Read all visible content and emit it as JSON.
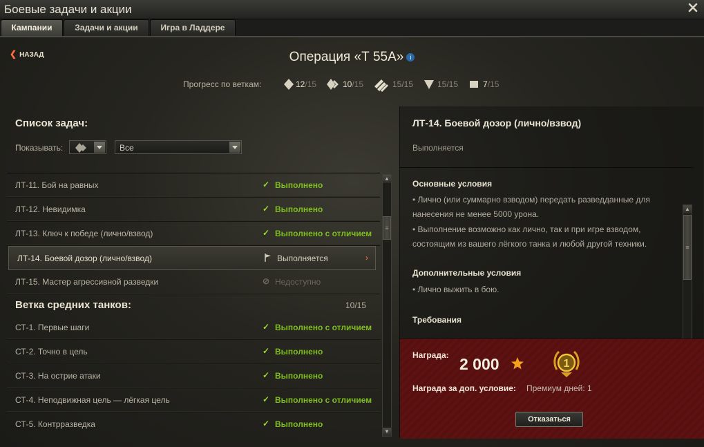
{
  "window": {
    "title": "Боевые задачи и акции"
  },
  "tabs": [
    {
      "label": "Кампании"
    },
    {
      "label": "Задачи и акции"
    },
    {
      "label": "Игра в Ладдере"
    }
  ],
  "header": {
    "back_label": "НАЗАД",
    "operation_title": "Операция «Т 55А»",
    "progress_label": "Прогресс по веткам:",
    "progress": [
      {
        "icon": "light-tank-icon",
        "done": "12",
        "total": "/15"
      },
      {
        "icon": "medium-tank-icon",
        "done": "10",
        "total": "/15"
      },
      {
        "icon": "heavy-tank-icon",
        "done": "",
        "total": "15/15"
      },
      {
        "icon": "tank-destroyer-icon",
        "done": "",
        "total": "15/15"
      },
      {
        "icon": "spg-icon",
        "done": "7",
        "total": "/15"
      }
    ]
  },
  "tasklist": {
    "heading": "Список задач:",
    "filter_label": "Показывать:",
    "filter_value": "Все",
    "rows": [
      {
        "name": "ЛТ-11. Бой на равных",
        "status": "Выполнено",
        "state": "done"
      },
      {
        "name": "ЛТ-12. Невидимка",
        "status": "Выполнено",
        "state": "done"
      },
      {
        "name": "ЛТ-13. Ключ к победе (лично/взвод)",
        "status": "Выполнено с отличием",
        "state": "done"
      },
      {
        "name": "ЛТ-14. Боевой дозор (лично/взвод)",
        "status": "Выполняется",
        "state": "active"
      },
      {
        "name": "ЛТ-15. Мастер агрессивной разведки",
        "status": "Недоступно",
        "state": "locked"
      }
    ],
    "section": {
      "title": "Ветка средних танков:",
      "count": "10/15"
    },
    "rows2": [
      {
        "name": "СТ-1. Первые шаги",
        "status": "Выполнено с отличием"
      },
      {
        "name": "СТ-2. Точно в цель",
        "status": "Выполнено"
      },
      {
        "name": "СТ-3. На острие атаки",
        "status": "Выполнено"
      },
      {
        "name": "СТ-4. Неподвижная цель — лёгкая цель",
        "status": "Выполнено с отличием"
      },
      {
        "name": "СТ-5. Контрразведка",
        "status": "Выполнено"
      }
    ]
  },
  "details": {
    "title": "ЛТ-14. Боевой дозор (лично/взвод)",
    "status": "Выполняется",
    "main_conditions_title": "Основные условия",
    "main_conditions": [
      "• Лично (или суммарно взводом) передать разведданные для нанесения не менее 5000 урона.",
      "• Выполнение возможно как лично, так и при игре взводом, состоящим из вашего лёгкого танка и любой другой техники."
    ],
    "extra_conditions_title": "Дополнительные условия",
    "extra_conditions": "• Лично выжить в бою.",
    "requirements_title": "Требования"
  },
  "reward": {
    "label": "Награда:",
    "value": "2 000",
    "extra_label": "Награда за доп. условие:",
    "extra_value": "Премиум дней: 1",
    "refuse_label": "Отказаться",
    "medal_number": "1"
  }
}
